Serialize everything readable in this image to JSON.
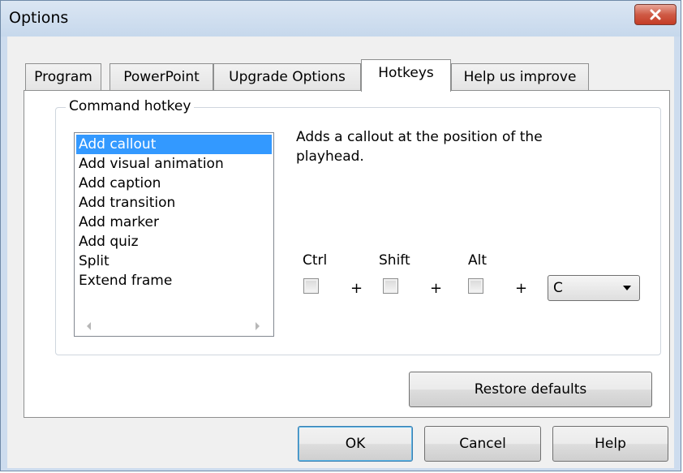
{
  "window": {
    "title": "Options"
  },
  "tabs": [
    {
      "label": "Program"
    },
    {
      "label": "PowerPoint"
    },
    {
      "label": "Upgrade Options"
    },
    {
      "label": "Hotkeys"
    },
    {
      "label": "Help us improve"
    }
  ],
  "active_tab": "Hotkeys",
  "hotkeys": {
    "group_label": "Command hotkey",
    "commands": [
      "Add callout",
      "Add visual animation",
      "Add caption",
      "Add transition",
      "Add marker",
      "Add quiz",
      "Split",
      "Extend frame"
    ],
    "selected_command": "Add callout",
    "description": "Adds a callout at the position of the playhead.",
    "modifiers": {
      "ctrl_label": "Ctrl",
      "shift_label": "Shift",
      "alt_label": "Alt",
      "ctrl_checked": false,
      "shift_checked": false,
      "alt_checked": false
    },
    "plus": "+",
    "key_value": "C",
    "restore_label": "Restore defaults"
  },
  "footer": {
    "ok_label": "OK",
    "cancel_label": "Cancel",
    "help_label": "Help"
  },
  "icons": {
    "close": "close-icon",
    "scroll_left": "scroll-left-icon",
    "scroll_right": "scroll-right-icon",
    "dropdown": "chevron-down-icon"
  },
  "colors": {
    "selection": "#3399ff",
    "close_button": "#c43c26",
    "titlebar": "#cddcee"
  }
}
